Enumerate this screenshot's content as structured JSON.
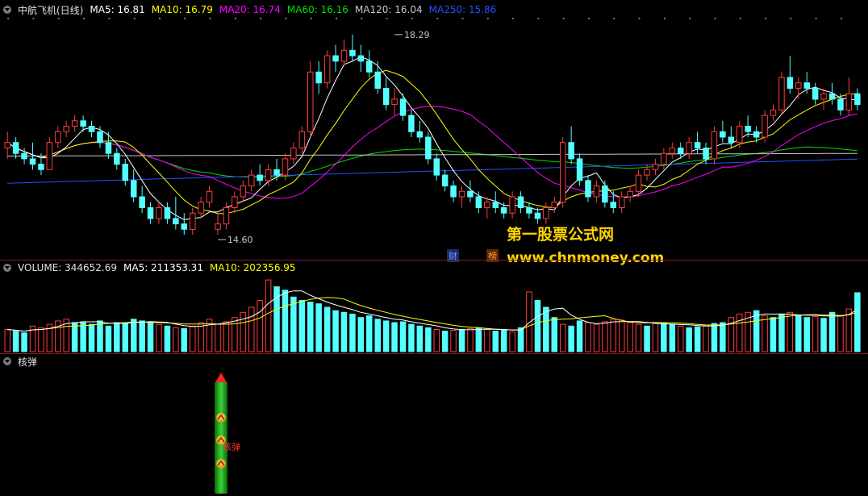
{
  "main_header": {
    "title": "中航飞机(日线)",
    "ma5": "MA5: 16.81",
    "ma10": "MA10: 16.79",
    "ma20": "MA20: 16.74",
    "ma60": "MA60: 16.16",
    "ma120": "MA120: 16.04",
    "ma250": "MA250: 15.86"
  },
  "volume_header": {
    "volume": "VOLUME: 344652.69",
    "ma5": "MA5: 211353.31",
    "ma10": "MA10: 202356.95"
  },
  "indicator_header": {
    "name": "核弹"
  },
  "indicator_label": "核弹",
  "watermark": {
    "line1": "第一股票公式网",
    "line2": "www.chnmoney.com"
  },
  "badges": {
    "cai": "财",
    "bang": "榜"
  },
  "colors": {
    "up": "#ff3c3c",
    "down": "#54ffff",
    "ma5": "#ffffff",
    "ma10": "#ffff00",
    "ma20": "#ff00ff",
    "ma60": "#00e000",
    "ma120": "#c8c8c8",
    "ma250": "#2a4dff",
    "separator": "#8b1a1a",
    "watermark": "#ffd400"
  },
  "chart_data": [
    {
      "type": "candlestick",
      "title": "中航飞机(日线)",
      "ylim": [
        14.2,
        18.6
      ],
      "annotations": [
        {
          "label": "18.29",
          "index": 46,
          "value": 18.29
        },
        {
          "label": "14.60",
          "index": 25,
          "value": 14.6
        }
      ],
      "ohlc": [
        [
          16.2,
          16.5,
          16.0,
          16.3
        ],
        [
          16.3,
          16.4,
          16.0,
          16.1
        ],
        [
          16.1,
          16.2,
          15.9,
          16.0
        ],
        [
          16.0,
          16.3,
          15.8,
          15.9
        ],
        [
          15.9,
          16.1,
          15.7,
          15.8
        ],
        [
          15.8,
          16.4,
          15.8,
          16.3
        ],
        [
          16.3,
          16.6,
          16.2,
          16.5
        ],
        [
          16.5,
          16.7,
          16.4,
          16.6
        ],
        [
          16.6,
          16.8,
          16.5,
          16.7
        ],
        [
          16.7,
          16.8,
          16.5,
          16.6
        ],
        [
          16.6,
          16.7,
          16.4,
          16.5
        ],
        [
          16.5,
          16.6,
          16.2,
          16.3
        ],
        [
          16.3,
          16.5,
          16.0,
          16.1
        ],
        [
          16.1,
          16.2,
          15.8,
          15.9
        ],
        [
          15.9,
          16.0,
          15.5,
          15.6
        ],
        [
          15.6,
          15.8,
          15.2,
          15.3
        ],
        [
          15.3,
          15.5,
          15.0,
          15.1
        ],
        [
          15.1,
          15.2,
          14.8,
          14.9
        ],
        [
          14.9,
          15.2,
          14.8,
          15.1
        ],
        [
          15.1,
          15.2,
          14.8,
          14.9
        ],
        [
          14.9,
          15.3,
          14.7,
          14.8
        ],
        [
          14.8,
          15.0,
          14.6,
          14.7
        ],
        [
          14.7,
          15.1,
          14.6,
          15.0
        ],
        [
          15.0,
          15.3,
          14.9,
          15.2
        ],
        [
          15.2,
          15.5,
          15.1,
          15.4
        ],
        [
          14.7,
          15.0,
          14.6,
          14.8
        ],
        [
          14.8,
          15.2,
          14.7,
          15.1
        ],
        [
          15.1,
          15.4,
          15.0,
          15.3
        ],
        [
          15.3,
          15.6,
          15.2,
          15.5
        ],
        [
          15.5,
          15.8,
          15.4,
          15.7
        ],
        [
          15.7,
          15.9,
          15.5,
          15.6
        ],
        [
          15.6,
          15.9,
          15.5,
          15.8
        ],
        [
          15.8,
          16.0,
          15.6,
          15.7
        ],
        [
          15.7,
          16.1,
          15.6,
          16.0
        ],
        [
          16.0,
          16.3,
          15.9,
          16.2
        ],
        [
          16.2,
          16.6,
          16.1,
          16.5
        ],
        [
          16.5,
          17.8,
          16.4,
          17.6
        ],
        [
          17.6,
          17.8,
          17.2,
          17.4
        ],
        [
          17.4,
          18.0,
          17.3,
          17.9
        ],
        [
          17.9,
          18.1,
          17.6,
          17.8
        ],
        [
          17.8,
          18.2,
          17.7,
          18.0
        ],
        [
          18.0,
          18.29,
          17.8,
          17.9
        ],
        [
          17.9,
          18.1,
          17.6,
          17.8
        ],
        [
          17.8,
          18.0,
          17.5,
          17.6
        ],
        [
          17.6,
          17.8,
          17.2,
          17.3
        ],
        [
          17.3,
          17.5,
          16.9,
          17.0
        ],
        [
          17.0,
          17.3,
          16.8,
          17.1
        ],
        [
          17.1,
          17.2,
          16.7,
          16.8
        ],
        [
          16.8,
          16.9,
          16.4,
          16.5
        ],
        [
          16.5,
          16.7,
          16.3,
          16.4
        ],
        [
          16.4,
          16.5,
          15.9,
          16.0
        ],
        [
          16.0,
          16.1,
          15.6,
          15.7
        ],
        [
          15.7,
          15.8,
          15.4,
          15.5
        ],
        [
          15.5,
          15.6,
          15.2,
          15.3
        ],
        [
          15.3,
          15.5,
          15.1,
          15.4
        ],
        [
          15.4,
          15.6,
          15.2,
          15.3
        ],
        [
          15.3,
          15.4,
          15.0,
          15.1
        ],
        [
          15.1,
          15.3,
          14.9,
          15.2
        ],
        [
          15.2,
          15.4,
          15.0,
          15.1
        ],
        [
          15.1,
          15.2,
          14.9,
          15.0
        ],
        [
          15.0,
          15.4,
          14.9,
          15.3
        ],
        [
          15.3,
          15.4,
          15.0,
          15.1
        ],
        [
          15.1,
          15.2,
          14.9,
          15.0
        ],
        [
          15.0,
          15.1,
          14.8,
          14.9
        ],
        [
          14.9,
          15.2,
          14.8,
          15.1
        ],
        [
          15.1,
          15.3,
          15.0,
          15.2
        ],
        [
          15.2,
          16.4,
          15.1,
          16.3
        ],
        [
          16.3,
          16.6,
          15.9,
          16.0
        ],
        [
          16.0,
          16.1,
          15.5,
          15.6
        ],
        [
          15.6,
          15.7,
          15.2,
          15.3
        ],
        [
          15.3,
          15.6,
          15.2,
          15.5
        ],
        [
          15.5,
          15.6,
          15.1,
          15.2
        ],
        [
          15.2,
          15.4,
          15.0,
          15.1
        ],
        [
          15.1,
          15.4,
          15.0,
          15.3
        ],
        [
          15.3,
          15.5,
          15.2,
          15.4
        ],
        [
          15.4,
          15.8,
          15.3,
          15.7
        ],
        [
          15.7,
          15.9,
          15.6,
          15.8
        ],
        [
          15.8,
          16.0,
          15.7,
          15.9
        ],
        [
          15.9,
          16.2,
          15.8,
          16.1
        ],
        [
          16.1,
          16.3,
          16.0,
          16.2
        ],
        [
          16.2,
          16.3,
          16.0,
          16.1
        ],
        [
          16.1,
          16.4,
          16.0,
          16.3
        ],
        [
          16.3,
          16.5,
          16.1,
          16.2
        ],
        [
          16.2,
          16.3,
          15.9,
          16.0
        ],
        [
          16.0,
          16.6,
          15.9,
          16.5
        ],
        [
          16.5,
          16.7,
          16.3,
          16.4
        ],
        [
          16.4,
          16.6,
          16.2,
          16.3
        ],
        [
          16.3,
          16.7,
          16.2,
          16.6
        ],
        [
          16.6,
          16.8,
          16.4,
          16.5
        ],
        [
          16.5,
          16.6,
          16.3,
          16.4
        ],
        [
          16.4,
          16.9,
          16.3,
          16.8
        ],
        [
          16.8,
          17.0,
          16.7,
          16.9
        ],
        [
          16.9,
          17.6,
          16.8,
          17.5
        ],
        [
          17.5,
          17.9,
          17.2,
          17.3
        ],
        [
          17.3,
          17.5,
          17.1,
          17.4
        ],
        [
          17.4,
          17.6,
          17.2,
          17.3
        ],
        [
          17.3,
          17.4,
          17.0,
          17.1
        ],
        [
          17.1,
          17.3,
          16.9,
          17.2
        ],
        [
          17.2,
          17.4,
          17.0,
          17.1
        ],
        [
          17.1,
          17.2,
          16.8,
          16.9
        ],
        [
          16.9,
          17.5,
          16.8,
          17.2
        ],
        [
          17.2,
          17.3,
          16.9,
          17.0
        ]
      ]
    },
    {
      "type": "bar",
      "title": "VOLUME",
      "values": [
        130,
        120,
        110,
        150,
        140,
        160,
        180,
        190,
        170,
        175,
        160,
        180,
        150,
        170,
        165,
        190,
        180,
        175,
        160,
        150,
        140,
        135,
        150,
        170,
        190,
        160,
        175,
        200,
        230,
        260,
        300,
        420,
        380,
        360,
        320,
        300,
        290,
        280,
        260,
        240,
        230,
        220,
        200,
        210,
        190,
        180,
        170,
        175,
        160,
        150,
        140,
        130,
        120,
        125,
        130,
        135,
        140,
        130,
        120,
        125,
        115,
        140,
        350,
        300,
        260,
        200,
        160,
        150,
        180,
        170,
        160,
        175,
        190,
        185,
        170,
        160,
        150,
        165,
        170,
        160,
        150,
        140,
        145,
        155,
        165,
        170,
        200,
        220,
        230,
        240,
        210,
        200,
        220,
        230,
        215,
        200,
        205,
        195,
        230,
        210,
        250,
        345
      ],
      "up": [
        true,
        false,
        false,
        true,
        true,
        true,
        true,
        true,
        false,
        false,
        false,
        false,
        false,
        false,
        false,
        false,
        false,
        false,
        true,
        false,
        true,
        false,
        true,
        true,
        true,
        true,
        true,
        true,
        true,
        true,
        true,
        true,
        false,
        false,
        false,
        false,
        false,
        false,
        false,
        false,
        false,
        false,
        false,
        false,
        false,
        false,
        false,
        false,
        false,
        false,
        false,
        true,
        false,
        true,
        false,
        true,
        false,
        true,
        false,
        false,
        true,
        false,
        true,
        false,
        false,
        false,
        true,
        false,
        false,
        true,
        true,
        true,
        true,
        true,
        true,
        true,
        false,
        true,
        false,
        false,
        true,
        false,
        false,
        true,
        false,
        false,
        true,
        true,
        true,
        false,
        true,
        false,
        false,
        true,
        false,
        false,
        true,
        false,
        false,
        true,
        true,
        false
      ]
    }
  ]
}
